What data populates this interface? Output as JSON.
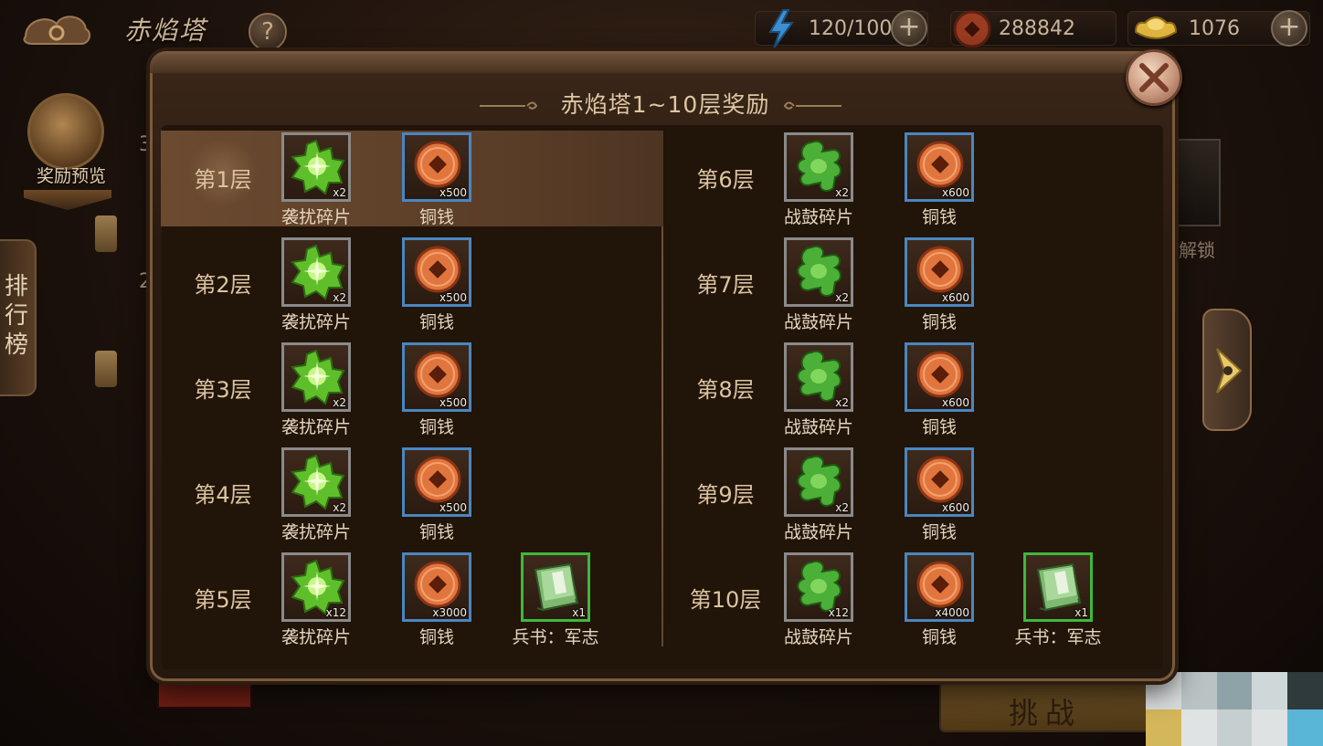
{
  "header": {
    "game_title": "赤焰塔",
    "help_label": "?",
    "resources": [
      {
        "name": "stamina",
        "value": "120/100",
        "icon": "lightning-icon"
      },
      {
        "name": "copper",
        "value": "288842",
        "icon": "coin-icon"
      },
      {
        "name": "gold",
        "value": "1076",
        "icon": "ingot-icon"
      }
    ],
    "plus_label": "+"
  },
  "sidebar": {
    "reward_preview_label": "奖励预览",
    "rank_label": "排行榜"
  },
  "background": {
    "digits": [
      "3",
      "2"
    ],
    "right_card_text": "解锁",
    "challenge_label": "挑战"
  },
  "modal": {
    "title": "赤焰塔1~10层奖励",
    "left_rows": [
      {
        "floor": "第1层",
        "items": [
          {
            "name": "袭扰碎片",
            "qty": "x2",
            "icon": "green-fragment-icon",
            "frame": "gray"
          },
          {
            "name": "铜钱",
            "qty": "x500",
            "icon": "copper-coin-icon",
            "frame": "blue"
          }
        ]
      },
      {
        "floor": "第2层",
        "items": [
          {
            "name": "袭扰碎片",
            "qty": "x2",
            "icon": "green-fragment-icon",
            "frame": "gray"
          },
          {
            "name": "铜钱",
            "qty": "x500",
            "icon": "copper-coin-icon",
            "frame": "blue"
          }
        ]
      },
      {
        "floor": "第3层",
        "items": [
          {
            "name": "袭扰碎片",
            "qty": "x2",
            "icon": "green-fragment-icon",
            "frame": "gray"
          },
          {
            "name": "铜钱",
            "qty": "x500",
            "icon": "copper-coin-icon",
            "frame": "blue"
          }
        ]
      },
      {
        "floor": "第4层",
        "items": [
          {
            "name": "袭扰碎片",
            "qty": "x2",
            "icon": "green-fragment-icon",
            "frame": "gray"
          },
          {
            "name": "铜钱",
            "qty": "x500",
            "icon": "copper-coin-icon",
            "frame": "blue"
          }
        ]
      },
      {
        "floor": "第5层",
        "items": [
          {
            "name": "袭扰碎片",
            "qty": "x12",
            "icon": "green-fragment-icon",
            "frame": "gray"
          },
          {
            "name": "铜钱",
            "qty": "x3000",
            "icon": "copper-coin-icon",
            "frame": "blue"
          },
          {
            "name": "兵书：军志",
            "qty": "x1",
            "icon": "war-book-icon",
            "frame": "green"
          }
        ]
      }
    ],
    "right_rows": [
      {
        "floor": "第6层",
        "items": [
          {
            "name": "战鼓碎片",
            "qty": "x2",
            "icon": "drum-fragment-icon",
            "frame": "gray"
          },
          {
            "name": "铜钱",
            "qty": "x600",
            "icon": "copper-coin-icon",
            "frame": "blue"
          }
        ]
      },
      {
        "floor": "第7层",
        "items": [
          {
            "name": "战鼓碎片",
            "qty": "x2",
            "icon": "drum-fragment-icon",
            "frame": "gray"
          },
          {
            "name": "铜钱",
            "qty": "x600",
            "icon": "copper-coin-icon",
            "frame": "blue"
          }
        ]
      },
      {
        "floor": "第8层",
        "items": [
          {
            "name": "战鼓碎片",
            "qty": "x2",
            "icon": "drum-fragment-icon",
            "frame": "gray"
          },
          {
            "name": "铜钱",
            "qty": "x600",
            "icon": "copper-coin-icon",
            "frame": "blue"
          }
        ]
      },
      {
        "floor": "第9层",
        "items": [
          {
            "name": "战鼓碎片",
            "qty": "x2",
            "icon": "drum-fragment-icon",
            "frame": "gray"
          },
          {
            "name": "铜钱",
            "qty": "x600",
            "icon": "copper-coin-icon",
            "frame": "blue"
          }
        ]
      },
      {
        "floor": "第10层",
        "items": [
          {
            "name": "战鼓碎片",
            "qty": "x12",
            "icon": "drum-fragment-icon",
            "frame": "gray"
          },
          {
            "name": "铜钱",
            "qty": "x4000",
            "icon": "copper-coin-icon",
            "frame": "blue"
          },
          {
            "name": "兵书：军志",
            "qty": "x1",
            "icon": "war-book-icon",
            "frame": "green"
          }
        ]
      }
    ],
    "highlighted_floor": "第1层"
  },
  "colors": {
    "panel_border": "#7c5a3a",
    "frame_blue": "#4a86c0",
    "frame_green": "#3fb83b",
    "frame_gray": "#8a8a8a",
    "highlight_row": "#6b4a30"
  }
}
